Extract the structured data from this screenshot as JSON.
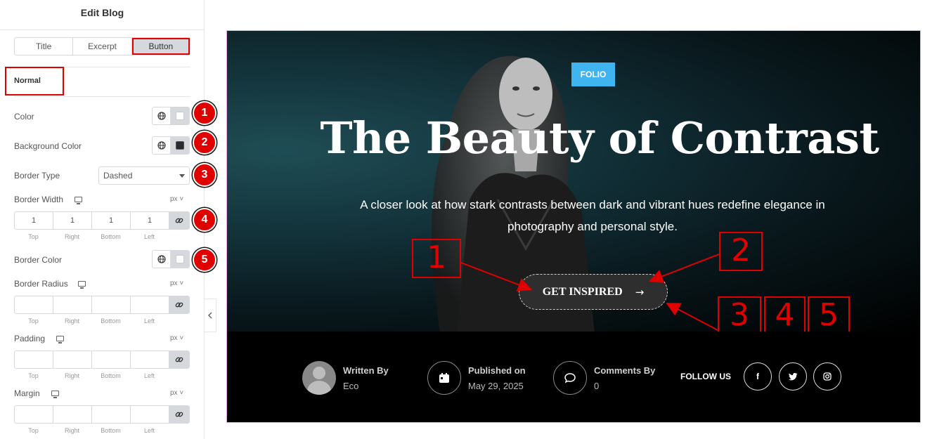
{
  "panel": {
    "title": "Edit Blog",
    "tabs": [
      {
        "label": "Title"
      },
      {
        "label": "Excerpt"
      },
      {
        "label": "Button"
      }
    ],
    "section": "Normal",
    "controls": {
      "color": "Color",
      "background_color": "Background Color",
      "border_type": "Border Type",
      "border_type_value": "Dashed",
      "border_width": "Border Width",
      "border_width_values": [
        "1",
        "1",
        "1",
        "1"
      ],
      "border_color": "Border Color",
      "border_radius": "Border Radius",
      "padding": "Padding",
      "margin": "Margin",
      "unit": "px",
      "dim_labels": [
        "Top",
        "Right",
        "Bottom",
        "Left"
      ]
    },
    "badges": [
      "1",
      "2",
      "3",
      "4",
      "5"
    ]
  },
  "preview": {
    "category": "FOLIO",
    "title": "The Beauty of Contrast",
    "subtitle_line1": "A closer look at how stark contrasts between dark and vibrant hues redefine elegance in",
    "subtitle_line2": "photography and personal style.",
    "cta_label": "GET INSPIRED",
    "cta_arrow": "→",
    "annotations": [
      "1",
      "2",
      "3",
      "4",
      "5"
    ],
    "meta": {
      "author_title": "Written By",
      "author_value": "Eco",
      "published_title": "Published on",
      "published_value": "May 29, 2025",
      "comments_title": "Comments By",
      "comments_value": "0"
    },
    "follow_label": "FOLLOW US",
    "social": [
      {
        "icon": "facebook-icon",
        "glyph": "f"
      },
      {
        "icon": "twitter-icon",
        "glyph": ""
      },
      {
        "icon": "instagram-icon",
        "glyph": ""
      }
    ]
  },
  "colors": {
    "accent_red": "#e00000",
    "folio_blue": "#3fb4ef",
    "button_bg": "#2e2e2e"
  }
}
